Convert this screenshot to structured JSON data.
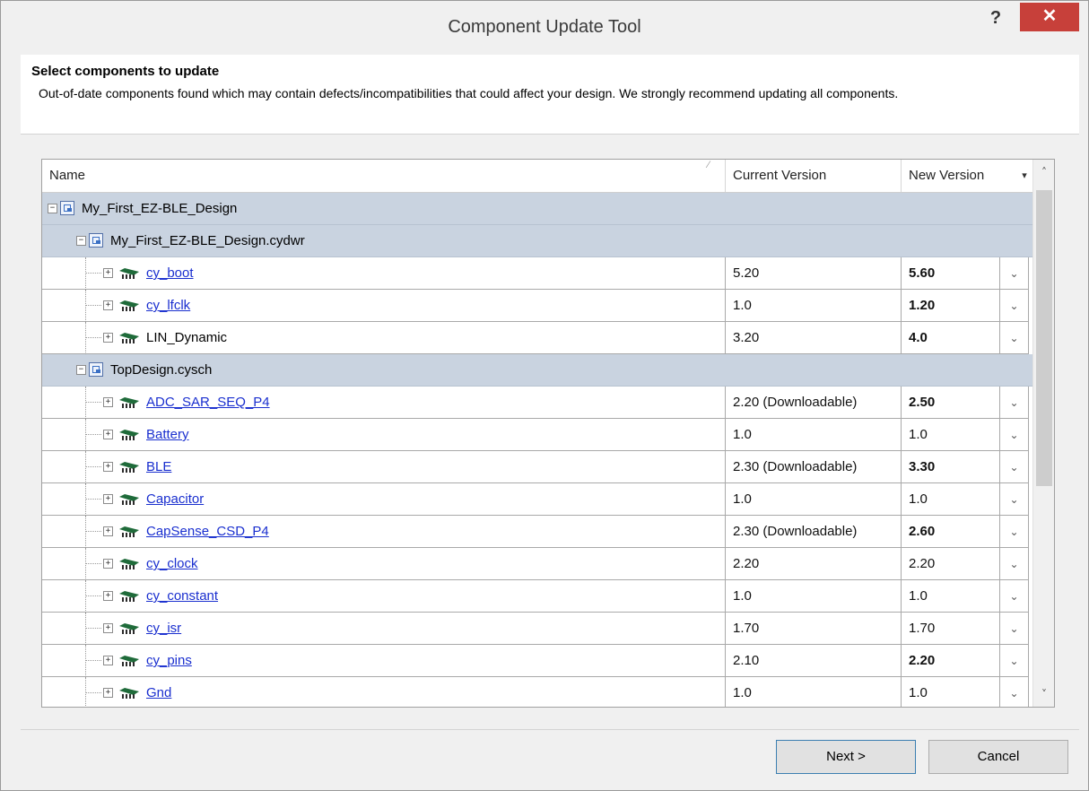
{
  "window": {
    "title": "Component Update Tool",
    "help_glyph": "?",
    "close_glyph": "✕"
  },
  "header": {
    "title": "Select components to update",
    "description": "Out-of-date components found which may contain defects/incompatibilities that could affect your design. We strongly recommend updating all components."
  },
  "grid": {
    "columns": [
      "Name",
      "Current Version",
      "New Version"
    ],
    "sort_glyph": "⁄",
    "menu_arrow": "▾",
    "root": {
      "expander": "−",
      "label": "My_First_EZ-BLE_Design"
    },
    "groups": [
      {
        "expander": "−",
        "label": "My_First_EZ-BLE_Design.cydwr",
        "items": [
          {
            "expander": "+",
            "name": "cy_boot",
            "link": true,
            "current": "5.20",
            "new": "5.60",
            "bold": true
          },
          {
            "expander": "+",
            "name": "cy_lfclk",
            "link": true,
            "current": "1.0",
            "new": "1.20",
            "bold": true
          },
          {
            "expander": "+",
            "name": "LIN_Dynamic",
            "link": false,
            "current": "3.20",
            "new": "4.0",
            "bold": true
          }
        ]
      },
      {
        "expander": "−",
        "label": "TopDesign.cysch",
        "items": [
          {
            "expander": "+",
            "name": "ADC_SAR_SEQ_P4",
            "link": true,
            "current": "2.20 (Downloadable)",
            "new": "2.50",
            "bold": true
          },
          {
            "expander": "+",
            "name": "Battery",
            "link": true,
            "current": "1.0",
            "new": "1.0",
            "bold": false
          },
          {
            "expander": "+",
            "name": "BLE",
            "link": true,
            "current": "2.30 (Downloadable)",
            "new": "3.30",
            "bold": true
          },
          {
            "expander": "+",
            "name": "Capacitor",
            "link": true,
            "current": "1.0",
            "new": "1.0",
            "bold": false
          },
          {
            "expander": "+",
            "name": "CapSense_CSD_P4",
            "link": true,
            "current": "2.30 (Downloadable)",
            "new": "2.60",
            "bold": true
          },
          {
            "expander": "+",
            "name": "cy_clock",
            "link": true,
            "current": "2.20",
            "new": "2.20",
            "bold": false
          },
          {
            "expander": "+",
            "name": "cy_constant",
            "link": true,
            "current": "1.0",
            "new": "1.0",
            "bold": false
          },
          {
            "expander": "+",
            "name": "cy_isr",
            "link": true,
            "current": "1.70",
            "new": "1.70",
            "bold": false
          },
          {
            "expander": "+",
            "name": "cy_pins",
            "link": true,
            "current": "2.10",
            "new": "2.20",
            "bold": true
          },
          {
            "expander": "+",
            "name": "Gnd",
            "link": true,
            "current": "1.0",
            "new": "1.0",
            "bold": false
          }
        ]
      }
    ],
    "dropdown_glyph": "⌄",
    "scroll_up_glyph": "˄",
    "scroll_down_glyph": "˅"
  },
  "buttons": {
    "next": "Next >",
    "cancel": "Cancel"
  },
  "colors": {
    "group_row_bg": "#c9d3e0",
    "link": "#1a2fcf",
    "close_button": "#c7403a",
    "component_icon": "#1f6b3a"
  }
}
